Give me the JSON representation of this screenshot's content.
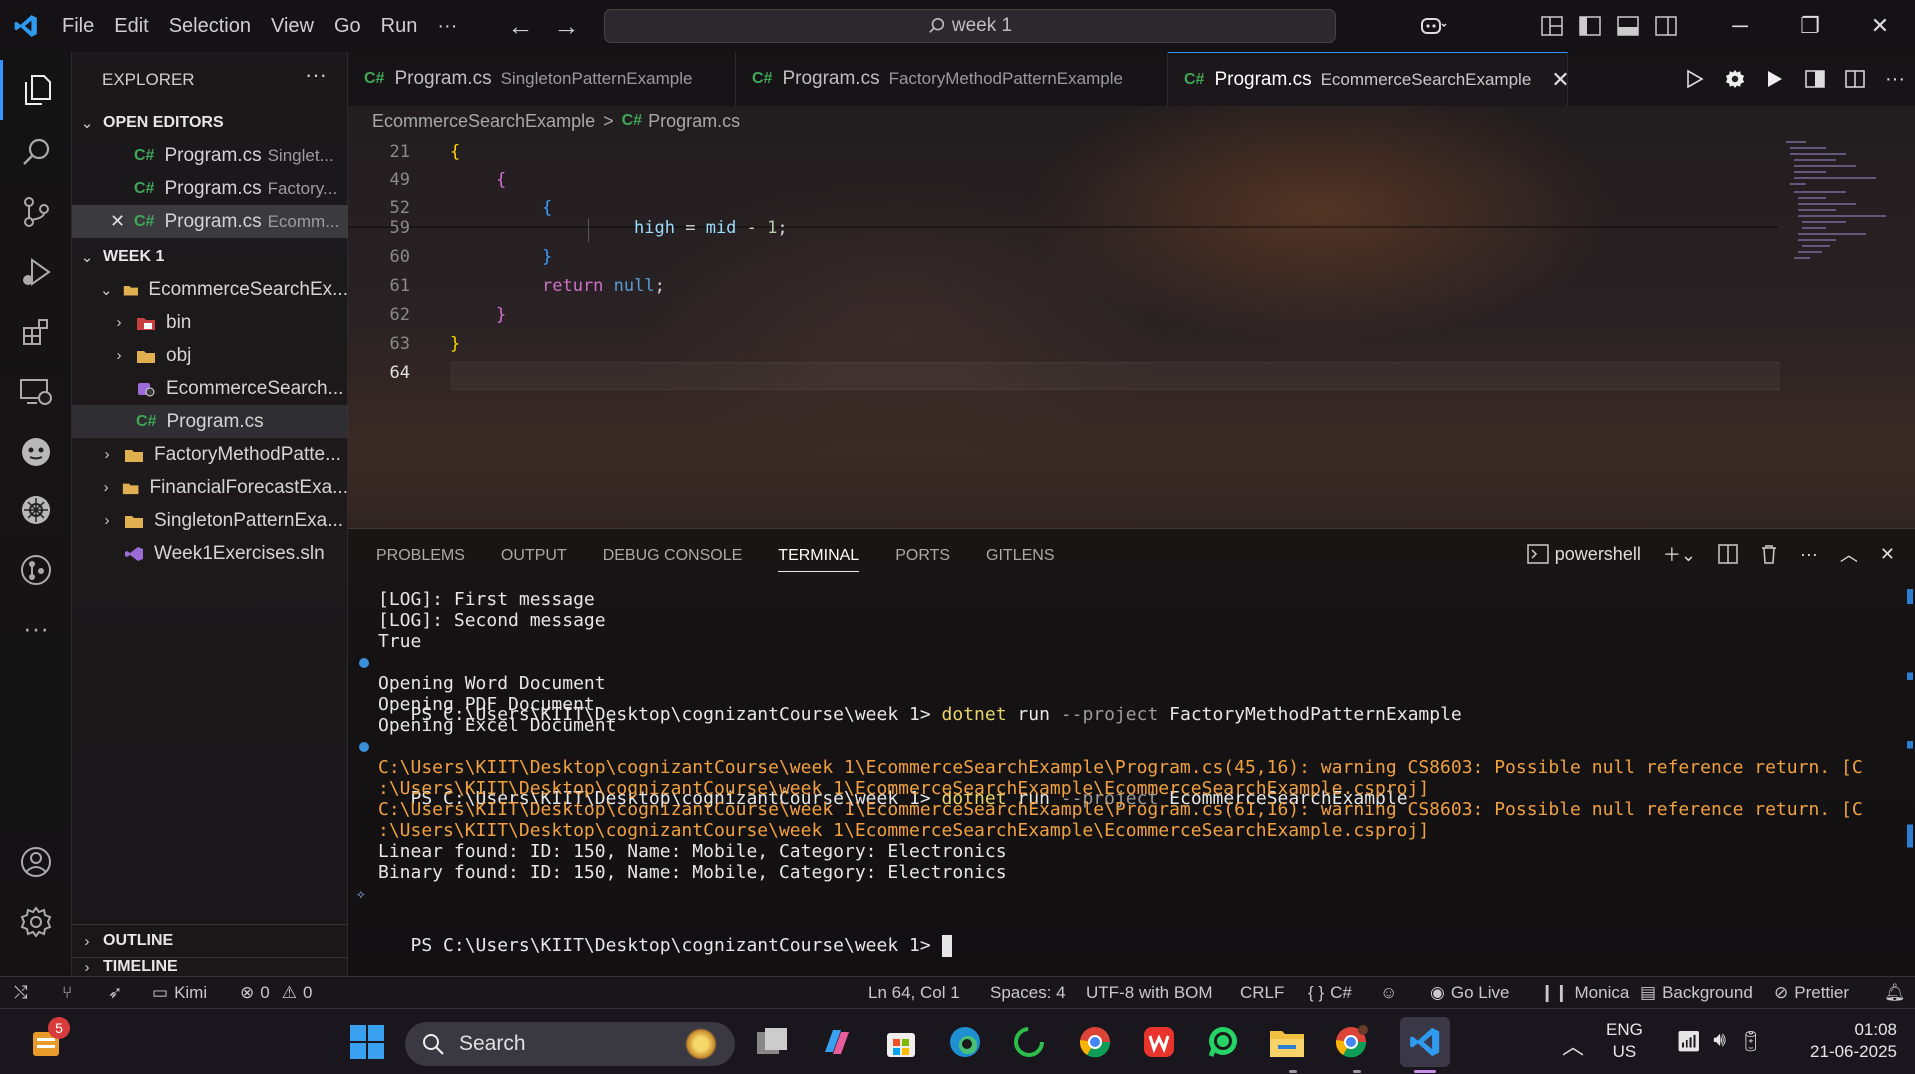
{
  "menu": {
    "items": [
      "File",
      "Edit",
      "Selection",
      "View",
      "Go",
      "Run"
    ],
    "more": "···"
  },
  "command_center": {
    "text": "week 1"
  },
  "explorer": {
    "title": "EXPLORER",
    "more": "···",
    "open_editors_label": "OPEN EDITORS",
    "open_editors": [
      {
        "name": "Program.cs",
        "desc": "Singlet..."
      },
      {
        "name": "Program.cs",
        "desc": "Factory..."
      },
      {
        "name": "Program.cs",
        "desc": "Ecomm..."
      }
    ],
    "workspace_label": "WEEK 1",
    "tree": {
      "ecommerce": "EcommerceSearchEx...",
      "bin": "bin",
      "obj": "obj",
      "csproj": "EcommerceSearch...",
      "program": "Program.cs",
      "factory": "FactoryMethodPatte...",
      "financial": "FinancialForecastExa...",
      "singleton": "SingletonPatternExa...",
      "sln": "Week1Exercises.sln"
    },
    "outline": "OUTLINE",
    "timeline": "TIMELINE"
  },
  "tabs": [
    {
      "name": "Program.cs",
      "desc": "SingletonPatternExample"
    },
    {
      "name": "Program.cs",
      "desc": "FactoryMethodPatternExample"
    },
    {
      "name": "Program.cs",
      "desc": "EcommerceSearchExample",
      "close": "✕"
    }
  ],
  "breadcrumb": {
    "folder": "EcommerceSearchExample",
    "sep": ">",
    "file": "Program.cs"
  },
  "code": {
    "line_numbers": [
      "21",
      "49",
      "52",
      "59",
      "60",
      "61",
      "62",
      "63",
      "64"
    ],
    "l59": {
      "a": "high",
      "b": "=",
      "c": "mid",
      "d": "-",
      "e": "1",
      "f": ";"
    },
    "l61": {
      "kw": "return",
      "val": "null",
      "end": ";"
    }
  },
  "panel": {
    "tabs": [
      "PROBLEMS",
      "OUTPUT",
      "DEBUG CONSOLE",
      "TERMINAL",
      "PORTS",
      "GITLENS"
    ],
    "shell": "powershell"
  },
  "terminal": {
    "lines": [
      "[LOG]: First message",
      "[LOG]: Second message",
      "True",
      "Opening Word Document",
      "Opening PDF Document",
      "Opening Excel Document",
      "C:\\Users\\KIIT\\Desktop\\cognizantCourse\\week 1\\EcommerceSearchExample\\Program.cs(45,16): warning CS8603: Possible null reference return. [C",
      ":\\Users\\KIIT\\Desktop\\cognizantCourse\\week 1\\EcommerceSearchExample\\EcommerceSearchExample.csproj]",
      "C:\\Users\\KIIT\\Desktop\\cognizantCourse\\week 1\\EcommerceSearchExample\\Program.cs(61,16): warning CS8603: Possible null reference return. [C",
      ":\\Users\\KIIT\\Desktop\\cognizantCourse\\week 1\\EcommerceSearchExample\\EcommerceSearchExample.csproj]",
      "Linear found: ID: 150, Name: Mobile, Category: Electronics",
      "Binary found: ID: 150, Name: Mobile, Category: Electronics"
    ],
    "prompt": "PS C:\\Users\\KIIT\\Desktop\\cognizantCourse\\week 1>",
    "cmd1": {
      "exe": "dotnet",
      "run": "run",
      "flag": "--project",
      "arg": "FactoryMethodPatternExample"
    },
    "cmd2": {
      "exe": "dotnet",
      "run": "run",
      "flag": "--project",
      "arg": "EcommerceSearchExample"
    }
  },
  "status": {
    "kimi": "Kimi",
    "errors": "0",
    "warnings": "0",
    "position": "Ln 64, Col 1",
    "spaces": "Spaces: 4",
    "encoding": "UTF-8 with BOM",
    "eol": "CRLF",
    "language": "C#",
    "golive": "Go Live",
    "monica": "Monica",
    "background": "Background",
    "prettier": "Prettier"
  },
  "taskbar": {
    "search": "Search",
    "badge": "5",
    "lang1": "ENG",
    "lang2": "US",
    "time": "01:08",
    "date": "21-06-2025"
  },
  "colors": {
    "accent": "#3794ff",
    "warning": "#f0a040",
    "csharp": "#3fa856"
  }
}
